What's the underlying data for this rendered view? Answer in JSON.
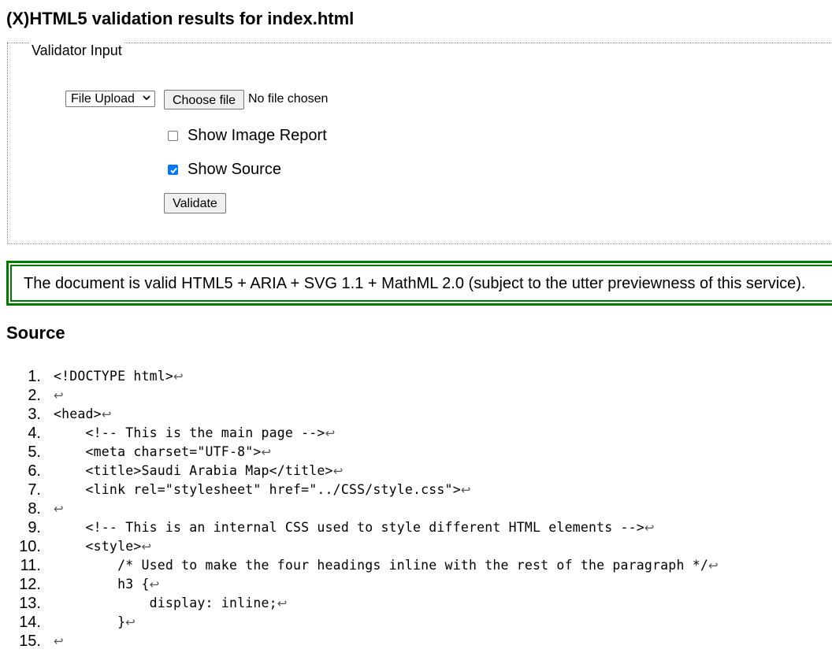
{
  "page": {
    "title": "(X)HTML5 validation results for index.html"
  },
  "validator_input": {
    "legend": "Validator Input",
    "input_mode": {
      "selected": "File Upload"
    },
    "file_picker": {
      "button_label": "Choose file",
      "status": "No file chosen"
    },
    "options": [
      {
        "label": "Show Image Report",
        "checked": false
      },
      {
        "label": "Show Source",
        "checked": true
      }
    ],
    "validate_label": "Validate"
  },
  "result": {
    "message": "The document is valid HTML5 + ARIA + SVG 1.1 + MathML 2.0 (subject to the utter previewness of this service).",
    "status_color": "#007a00"
  },
  "source": {
    "heading": "Source",
    "return_glyph": "↩",
    "lines": [
      {
        "n": "1.",
        "text": "<!DOCTYPE html>"
      },
      {
        "n": "2.",
        "text": ""
      },
      {
        "n": "3.",
        "text": "<head>"
      },
      {
        "n": "4.",
        "text": "    <!-- This is the main page -->"
      },
      {
        "n": "5.",
        "text": "    <meta charset=\"UTF-8\">"
      },
      {
        "n": "6.",
        "text": "    <title>Saudi Arabia Map</title>"
      },
      {
        "n": "7.",
        "text": "    <link rel=\"stylesheet\" href=\"../CSS/style.css\">"
      },
      {
        "n": "8.",
        "text": ""
      },
      {
        "n": "9.",
        "text": "    <!-- This is an internal CSS used to style different HTML elements -->"
      },
      {
        "n": "10.",
        "text": "    <style>"
      },
      {
        "n": "11.",
        "text": "        /* Used to make the four headings inline with the rest of the paragraph */"
      },
      {
        "n": "12.",
        "text": "        h3 {"
      },
      {
        "n": "13.",
        "text": "            display: inline;"
      },
      {
        "n": "14.",
        "text": "        }"
      },
      {
        "n": "15.",
        "text": ""
      }
    ]
  }
}
